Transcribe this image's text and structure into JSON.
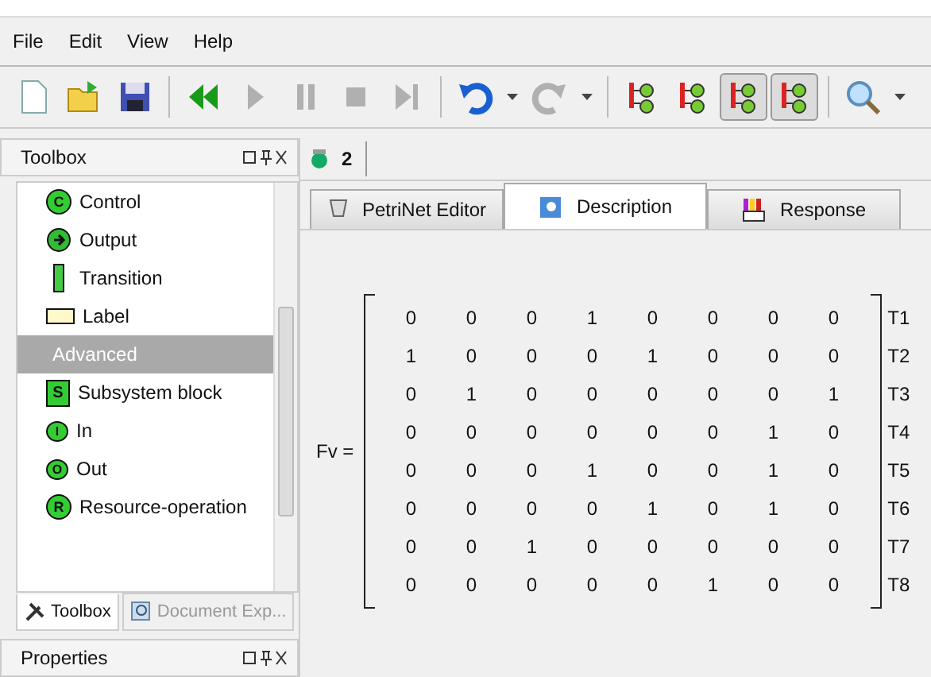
{
  "menu": [
    "File",
    "Edit",
    "View",
    "Help"
  ],
  "toolbar": [
    {
      "kind": "new",
      "pressed": false
    },
    {
      "kind": "open",
      "pressed": false
    },
    {
      "kind": "save",
      "pressed": false
    },
    {
      "kind": "sep"
    },
    {
      "kind": "rewind",
      "pressed": false,
      "disabled": false
    },
    {
      "kind": "play",
      "pressed": false,
      "disabled": true
    },
    {
      "kind": "pause",
      "pressed": false,
      "disabled": true
    },
    {
      "kind": "stop",
      "pressed": false,
      "disabled": true
    },
    {
      "kind": "end",
      "pressed": false,
      "disabled": true
    },
    {
      "kind": "sep"
    },
    {
      "kind": "undo",
      "pressed": false,
      "disabled": false
    },
    {
      "kind": "drop"
    },
    {
      "kind": "redo",
      "pressed": false,
      "disabled": true
    },
    {
      "kind": "drop"
    },
    {
      "kind": "sep"
    },
    {
      "kind": "net1",
      "pressed": false
    },
    {
      "kind": "net2",
      "pressed": false
    },
    {
      "kind": "net3",
      "pressed": true
    },
    {
      "kind": "net4",
      "pressed": true
    },
    {
      "kind": "sep"
    },
    {
      "kind": "search",
      "pressed": false
    },
    {
      "kind": "drop"
    }
  ],
  "toolbox": {
    "title": "Toolbox",
    "items": [
      {
        "kind": "circle",
        "badge": "C",
        "label": "Control",
        "selected": false
      },
      {
        "kind": "output",
        "label": "Output",
        "selected": false
      },
      {
        "kind": "transition",
        "label": "Transition",
        "selected": false
      },
      {
        "kind": "label",
        "label": "Label",
        "selected": false
      },
      {
        "kind": "header",
        "label": "Advanced",
        "selected": true
      },
      {
        "kind": "square",
        "badge": "S",
        "label": "Subsystem block",
        "selected": false
      },
      {
        "kind": "small",
        "badge": "I",
        "label": "In",
        "selected": false
      },
      {
        "kind": "small",
        "badge": "O",
        "label": "Out",
        "selected": false
      },
      {
        "kind": "circle",
        "badge": "R",
        "label": "Resource-operation",
        "selected": false
      }
    ],
    "tabs": [
      {
        "label": "Toolbox",
        "selected": true
      },
      {
        "label": "Document Exp...",
        "selected": false
      }
    ]
  },
  "properties": {
    "title": "Properties"
  },
  "document_tab": {
    "label": "2"
  },
  "tabs": [
    {
      "label": "PetriNet Editor",
      "selected": false
    },
    {
      "label": "Description",
      "selected": true
    },
    {
      "label": "Response",
      "selected": false
    }
  ],
  "matrix": {
    "name": "Fv =",
    "rows": [
      {
        "cells": [
          "0",
          "0",
          "0",
          "1",
          "0",
          "0",
          "0",
          "0"
        ],
        "label": "T1"
      },
      {
        "cells": [
          "1",
          "0",
          "0",
          "0",
          "1",
          "0",
          "0",
          "0"
        ],
        "label": "T2"
      },
      {
        "cells": [
          "0",
          "1",
          "0",
          "0",
          "0",
          "0",
          "0",
          "1"
        ],
        "label": "T3"
      },
      {
        "cells": [
          "0",
          "0",
          "0",
          "0",
          "0",
          "0",
          "1",
          "0"
        ],
        "label": "T4"
      },
      {
        "cells": [
          "0",
          "0",
          "0",
          "1",
          "0",
          "0",
          "1",
          "0"
        ],
        "label": "T5"
      },
      {
        "cells": [
          "0",
          "0",
          "0",
          "0",
          "1",
          "0",
          "1",
          "0"
        ],
        "label": "T6"
      },
      {
        "cells": [
          "0",
          "0",
          "1",
          "0",
          "0",
          "0",
          "0",
          "0"
        ],
        "label": "T7"
      },
      {
        "cells": [
          "0",
          "0",
          "0",
          "0",
          "0",
          "1",
          "0",
          "0"
        ],
        "label": "T8"
      }
    ]
  }
}
